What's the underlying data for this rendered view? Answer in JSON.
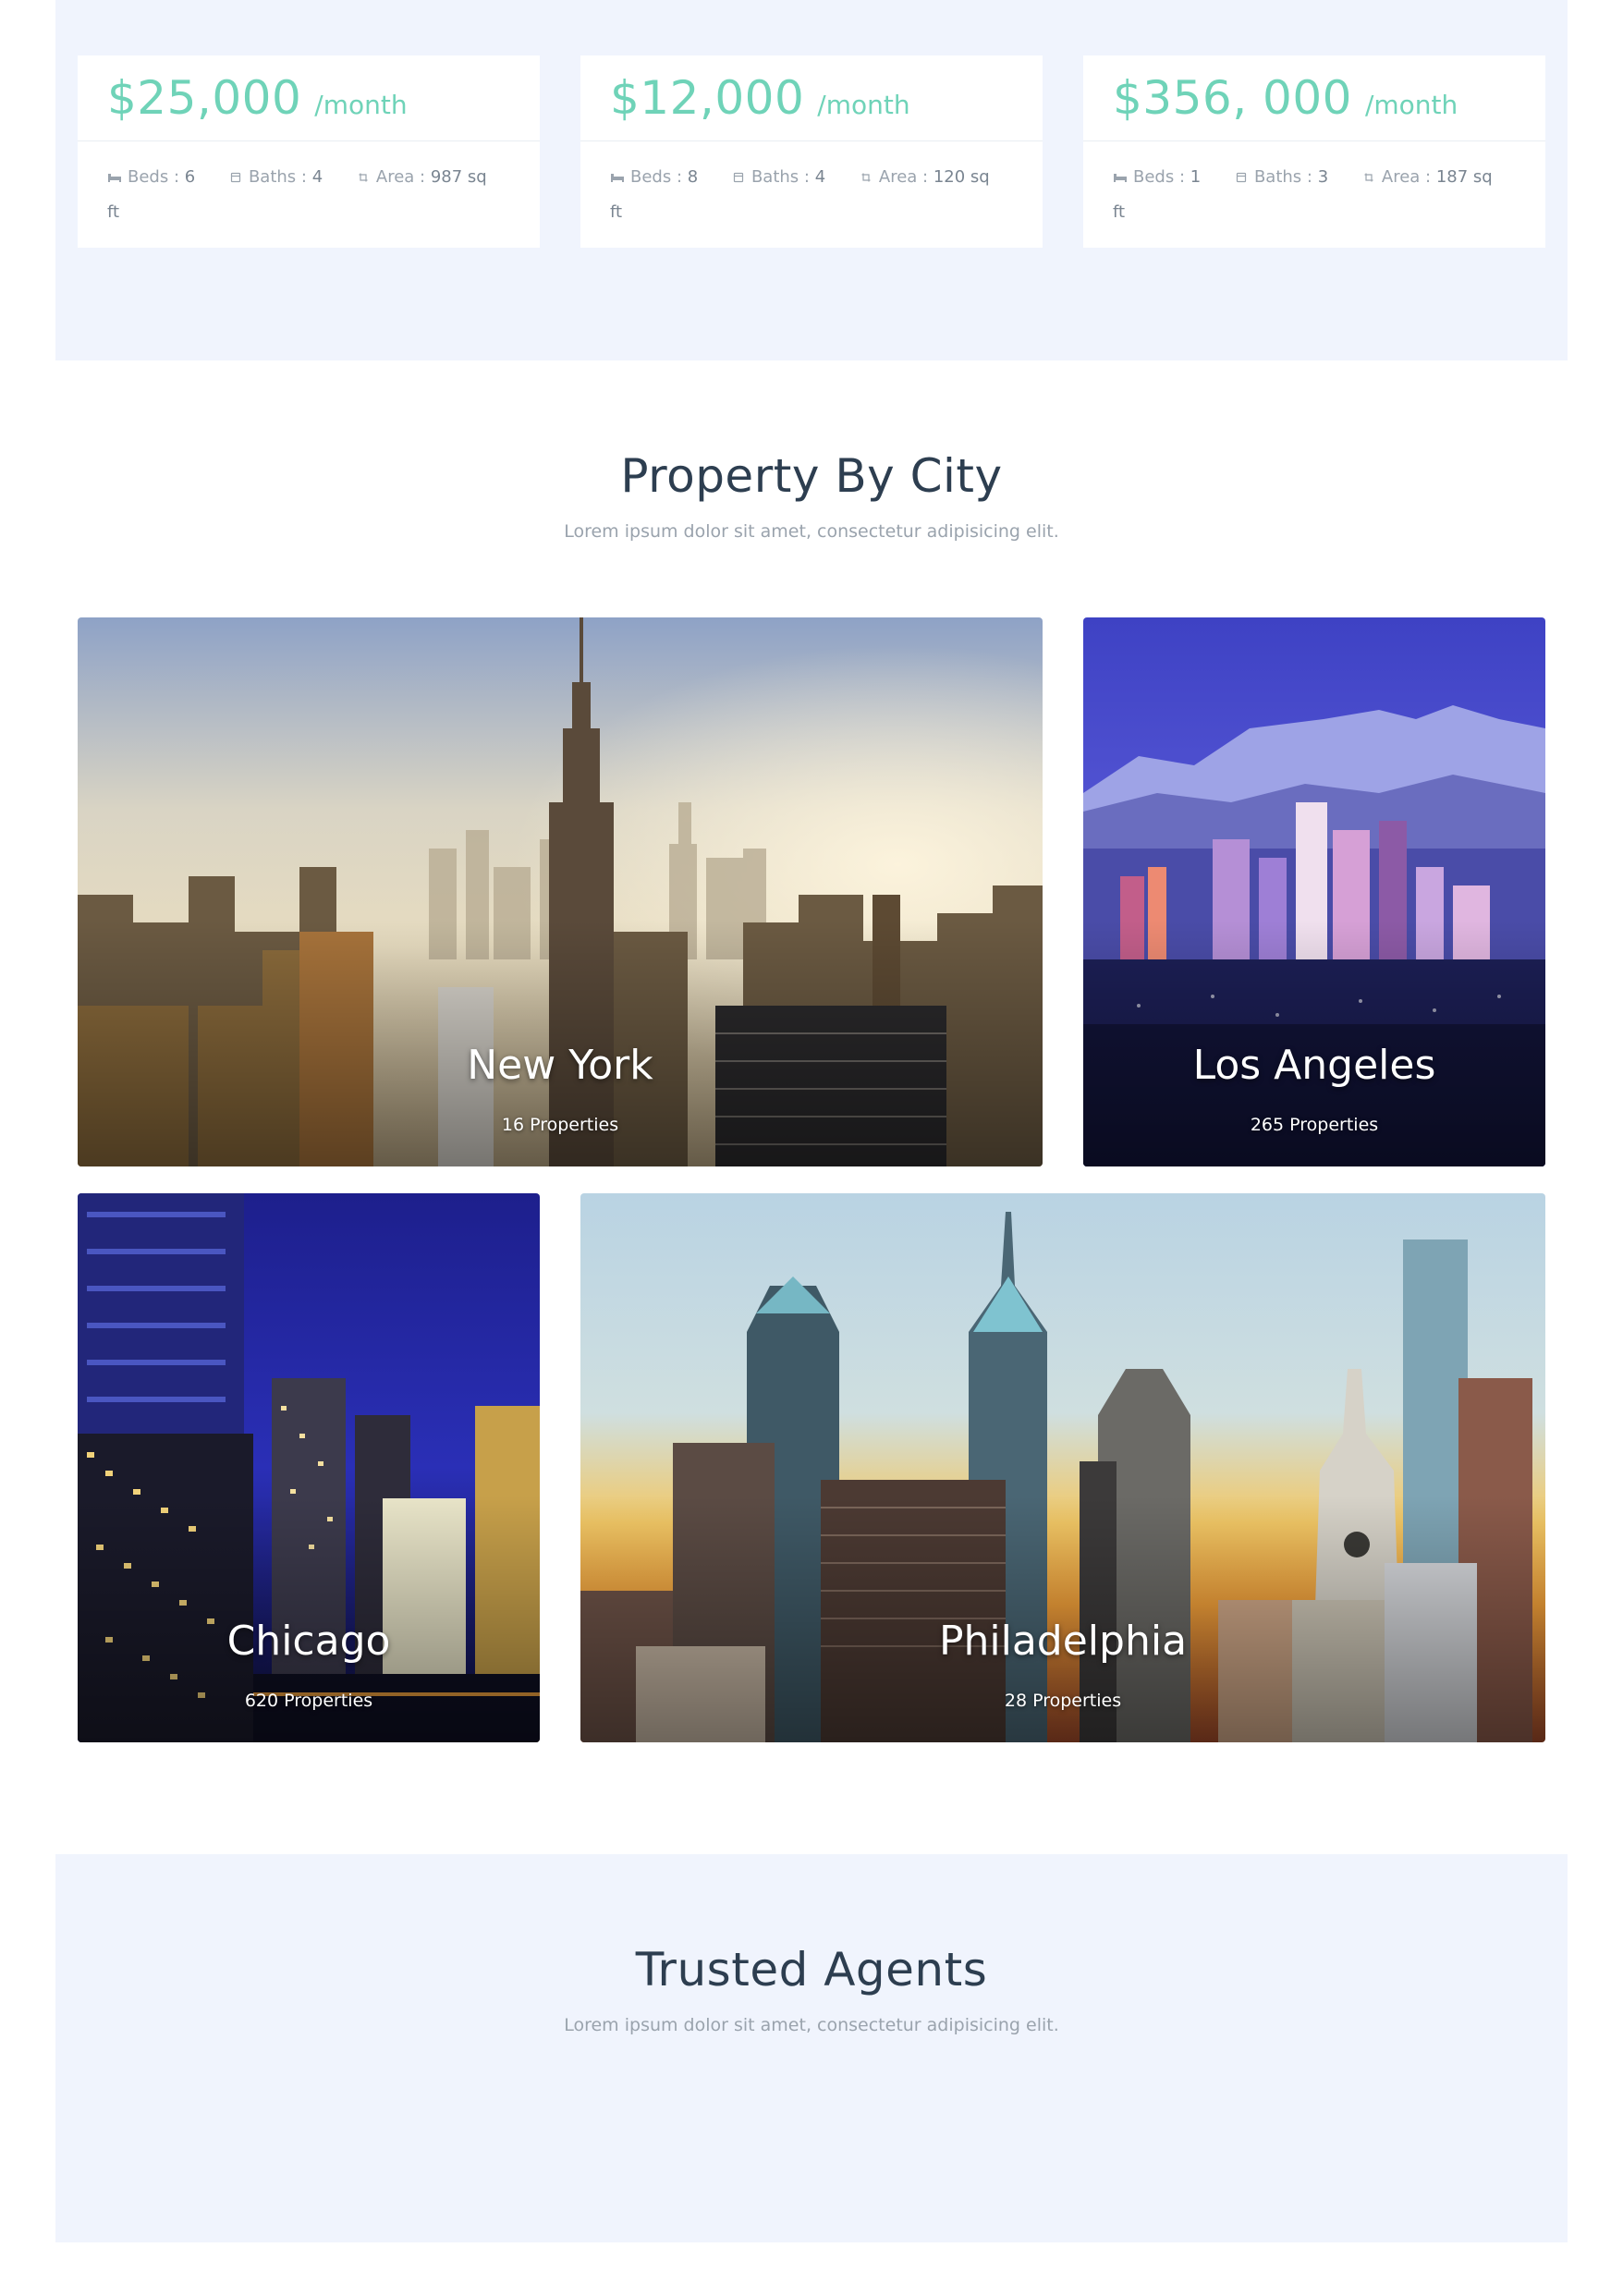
{
  "listings": [
    {
      "price": "$25,000",
      "per": "/month",
      "beds_label": "Beds :",
      "beds": "6",
      "baths_label": "Baths :",
      "baths": "4",
      "area_label": "Area :",
      "area": "987 sq",
      "area_unit": "ft"
    },
    {
      "price": "$12,000",
      "per": "/month",
      "beds_label": "Beds :",
      "beds": "8",
      "baths_label": "Baths :",
      "baths": "4",
      "area_label": "Area :",
      "area": "120 sq",
      "area_unit": "ft"
    },
    {
      "price": "$356, 000",
      "per": "/month",
      "beds_label": "Beds :",
      "beds": "1",
      "baths_label": "Baths :",
      "baths": "3",
      "area_label": "Area :",
      "area": "187 sq",
      "area_unit": "ft"
    }
  ],
  "city_section": {
    "title": "Property By City",
    "subtitle": "Lorem ipsum dolor sit amet, consectetur adipisicing elit."
  },
  "cities": [
    {
      "name": "New York",
      "count": "16 Properties"
    },
    {
      "name": "Los Angeles",
      "count": "265 Properties"
    },
    {
      "name": "Chicago",
      "count": "620 Properties"
    },
    {
      "name": "Philadelphia",
      "count": "28 Properties"
    }
  ],
  "agents_section": {
    "title": "Trusted Agents",
    "subtitle": "Lorem ipsum dolor sit amet, consectetur adipisicing elit."
  },
  "colors": {
    "accent": "#6fd3b8",
    "band": "#f0f4fd",
    "heading": "#2d3e50",
    "muted": "#9aa3ad"
  }
}
